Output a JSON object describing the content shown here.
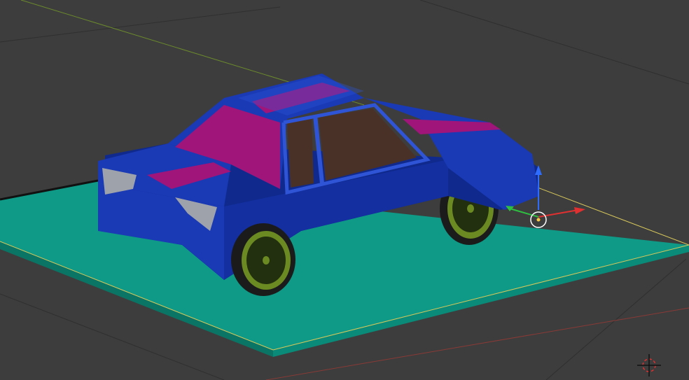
{
  "viewport": {
    "background": "#3d3d3d",
    "grid_line_color": "#2f2f2f",
    "x_axis_color": "#8a3a36",
    "y_axis_color": "#6b8a2c"
  },
  "scene": {
    "ground_plane_color": "#0e9a86",
    "ground_edge_color": "#0a7565",
    "ground_outline_color": "#d8c85a",
    "car": {
      "body_color": "#1a39b5",
      "body_dark_color": "#0f2a8c",
      "body_light_color": "#2f55d6",
      "stripe_color": "#a0157a",
      "window_color": "#4a3128",
      "light_color": "#9ea2aa",
      "tire_color": "#1b1b1b",
      "rim_color": "#6b8a22"
    }
  },
  "gizmo": {
    "x_arrow_color": "#e03030",
    "y_arrow_color": "#2ec040",
    "z_arrow_color": "#2e6bff",
    "pivot_color": "#ffffff"
  },
  "cursor_3d": {
    "icon": "crosshair-icon"
  }
}
